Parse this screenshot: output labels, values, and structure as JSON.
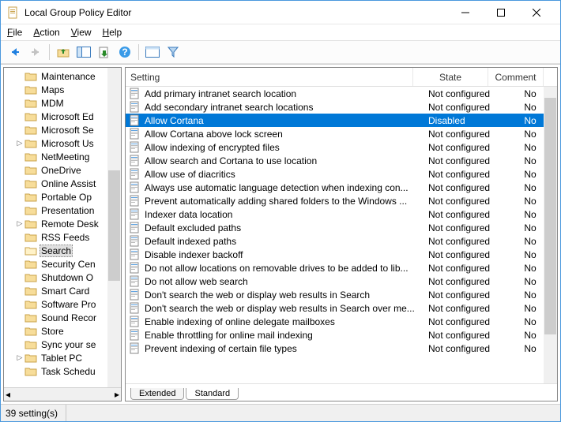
{
  "window": {
    "title": "Local Group Policy Editor"
  },
  "menu": {
    "file": "File",
    "action": "Action",
    "view": "View",
    "help": "Help"
  },
  "tree": {
    "items": [
      {
        "label": "Maintenance",
        "expander": ""
      },
      {
        "label": "Maps",
        "expander": ""
      },
      {
        "label": "MDM",
        "expander": ""
      },
      {
        "label": "Microsoft Ed",
        "expander": ""
      },
      {
        "label": "Microsoft Se",
        "expander": ""
      },
      {
        "label": "Microsoft Us",
        "expander": "▷"
      },
      {
        "label": "NetMeeting",
        "expander": ""
      },
      {
        "label": "OneDrive",
        "expander": ""
      },
      {
        "label": "Online Assist",
        "expander": ""
      },
      {
        "label": "Portable Op",
        "expander": ""
      },
      {
        "label": "Presentation",
        "expander": ""
      },
      {
        "label": "Remote Desk",
        "expander": "▷"
      },
      {
        "label": "RSS Feeds",
        "expander": ""
      },
      {
        "label": "Search",
        "expander": "",
        "selected": true
      },
      {
        "label": "Security Cen",
        "expander": ""
      },
      {
        "label": "Shutdown O",
        "expander": ""
      },
      {
        "label": "Smart Card",
        "expander": ""
      },
      {
        "label": "Software Pro",
        "expander": ""
      },
      {
        "label": "Sound Recor",
        "expander": ""
      },
      {
        "label": "Store",
        "expander": ""
      },
      {
        "label": "Sync your se",
        "expander": ""
      },
      {
        "label": "Tablet PC",
        "expander": "▷"
      },
      {
        "label": "Task Schedu",
        "expander": ""
      }
    ]
  },
  "list": {
    "columns": {
      "setting": "Setting",
      "state": "State",
      "comment": "Comment"
    },
    "rows": [
      {
        "setting": "Add primary intranet search location",
        "state": "Not configured",
        "comment": "No"
      },
      {
        "setting": "Add secondary intranet search locations",
        "state": "Not configured",
        "comment": "No"
      },
      {
        "setting": "Allow Cortana",
        "state": "Disabled",
        "comment": "No",
        "selected": true
      },
      {
        "setting": "Allow Cortana above lock screen",
        "state": "Not configured",
        "comment": "No"
      },
      {
        "setting": "Allow indexing of encrypted files",
        "state": "Not configured",
        "comment": "No"
      },
      {
        "setting": "Allow search and Cortana to use location",
        "state": "Not configured",
        "comment": "No"
      },
      {
        "setting": "Allow use of diacritics",
        "state": "Not configured",
        "comment": "No"
      },
      {
        "setting": "Always use automatic language detection when indexing con...",
        "state": "Not configured",
        "comment": "No"
      },
      {
        "setting": "Prevent automatically adding shared folders to the Windows ...",
        "state": "Not configured",
        "comment": "No"
      },
      {
        "setting": "Indexer data location",
        "state": "Not configured",
        "comment": "No"
      },
      {
        "setting": "Default excluded paths",
        "state": "Not configured",
        "comment": "No"
      },
      {
        "setting": "Default indexed paths",
        "state": "Not configured",
        "comment": "No"
      },
      {
        "setting": "Disable indexer backoff",
        "state": "Not configured",
        "comment": "No"
      },
      {
        "setting": "Do not allow locations on removable drives to be added to lib...",
        "state": "Not configured",
        "comment": "No"
      },
      {
        "setting": "Do not allow web search",
        "state": "Not configured",
        "comment": "No"
      },
      {
        "setting": "Don't search the web or display web results in Search",
        "state": "Not configured",
        "comment": "No"
      },
      {
        "setting": "Don't search the web or display web results in Search over me...",
        "state": "Not configured",
        "comment": "No"
      },
      {
        "setting": "Enable indexing of online delegate mailboxes",
        "state": "Not configured",
        "comment": "No"
      },
      {
        "setting": "Enable throttling for online mail indexing",
        "state": "Not configured",
        "comment": "No"
      },
      {
        "setting": "Prevent indexing of certain file types",
        "state": "Not configured",
        "comment": "No"
      }
    ]
  },
  "tabs": {
    "extended": "Extended",
    "standard": "Standard"
  },
  "status": {
    "text": "39 setting(s)"
  }
}
